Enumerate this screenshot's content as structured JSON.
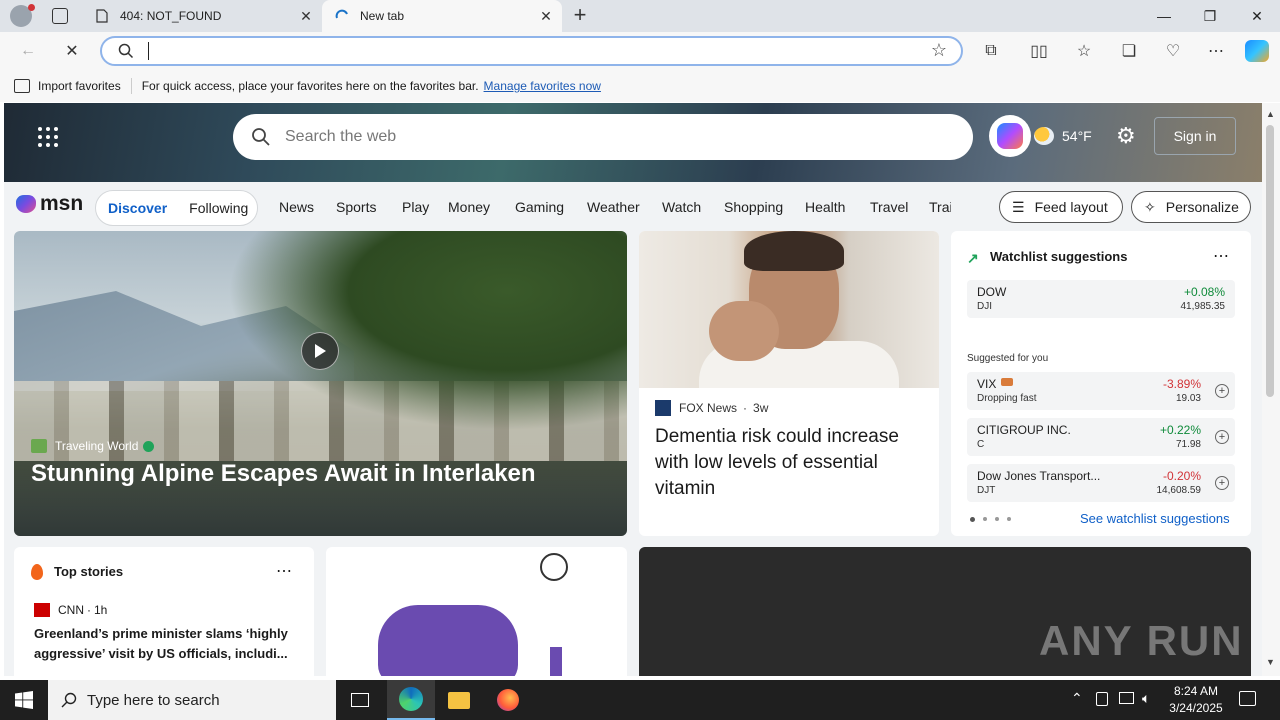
{
  "browser": {
    "tabs": [
      {
        "title": "404: NOT_FOUND"
      },
      {
        "title": "New tab"
      }
    ],
    "address_value": ""
  },
  "favorites_bar": {
    "import_label": "Import favorites",
    "message": "For quick access, place your favorites here on the favorites bar.",
    "manage_link": "Manage favorites now"
  },
  "msn_header": {
    "search_placeholder": "Search the web",
    "weather_temp": "54°F",
    "sign_in_label": "Sign in"
  },
  "msn_nav": {
    "logo_text": "msn",
    "discover_label": "Discover",
    "following_label": "Following",
    "links": [
      "News",
      "Sports",
      "Play",
      "Money",
      "Gaming",
      "Weather",
      "Watch",
      "Shopping",
      "Health",
      "Travel",
      "Trai"
    ],
    "feed_layout_label": "Feed layout",
    "personalize_label": "Personalize"
  },
  "hero": {
    "source": "Traveling World",
    "title": "Stunning Alpine Escapes Await in Interlaken"
  },
  "news_card": {
    "source": "FOX News",
    "age": "3w",
    "title": "Dementia risk could increase with low levels of essential vitamin"
  },
  "watchlist": {
    "title": "Watchlist suggestions",
    "primary": {
      "name": "DOW",
      "symbol": "DJI",
      "change": "+0.08%",
      "price": "41,985.35"
    },
    "suggested_label": "Suggested for you",
    "suggestions": [
      {
        "name": "VIX",
        "symbol": "Dropping fast",
        "change": "-3.89%",
        "price": "19.03",
        "direction": "down"
      },
      {
        "name": "CITIGROUP INC.",
        "symbol": "C",
        "change": "+0.22%",
        "price": "71.98",
        "direction": "up"
      },
      {
        "name": "Dow Jones Transport...",
        "symbol": "DJT",
        "change": "-0.20%",
        "price": "14,608.59",
        "direction": "down"
      }
    ],
    "see_link": "See watchlist suggestions"
  },
  "top_stories": {
    "title": "Top stories",
    "source": "CNN",
    "age": "1h",
    "headline": "Greenland’s prime minister slams ‘highly aggressive’ visit by US officials, includi..."
  },
  "watermark": "ANY RUN",
  "taskbar": {
    "search_placeholder": "Type here to search",
    "time": "8:24 AM",
    "date": "3/24/2025"
  },
  "colors": {
    "accent": "#1060c8",
    "up": "#0f8a3a",
    "down": "#d13438"
  }
}
